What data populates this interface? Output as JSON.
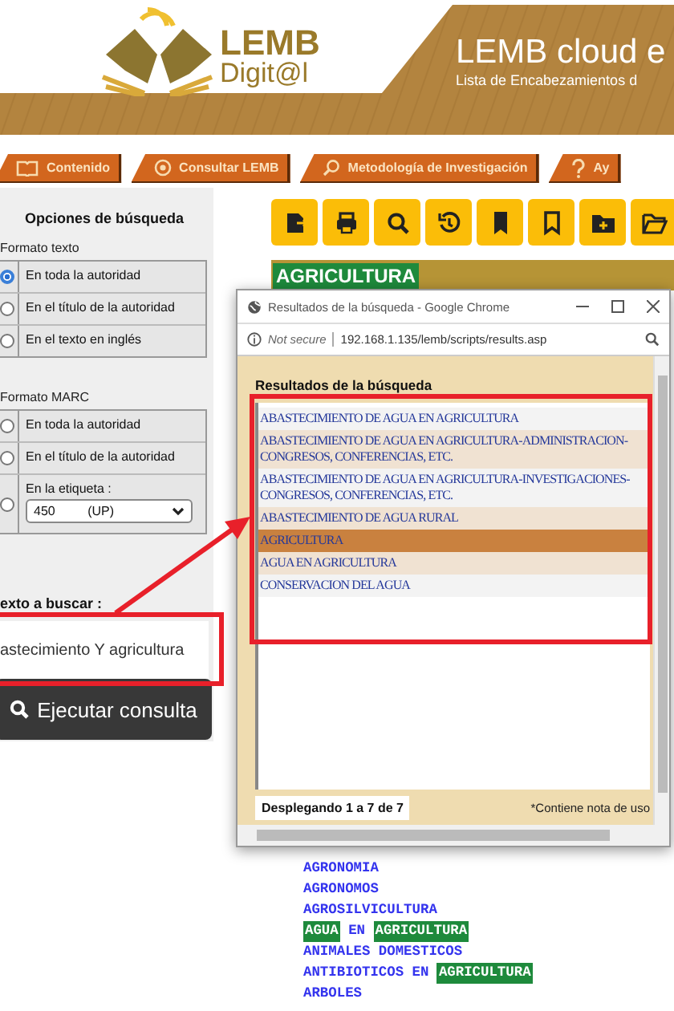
{
  "header": {
    "logo_line1": "LEMB",
    "logo_line2": "Digit@l",
    "title": "LEMB cloud e",
    "subtitle": "Lista de Encabezamientos d"
  },
  "nav_tabs": [
    "Contenido",
    "Consultar LEMB",
    "Metodología de Investigación",
    "Ay"
  ],
  "search_options": {
    "title": "Opciones de búsqueda",
    "groups": [
      {
        "label": "Formato texto",
        "options": [
          {
            "kind": "radio",
            "label": "En toda la autoridad",
            "selected": true
          },
          {
            "kind": "radio",
            "label": "En el título de la autoridad",
            "selected": false
          },
          {
            "kind": "radio",
            "label": "En el texto en inglés",
            "selected": false
          }
        ]
      },
      {
        "label": "Formato MARC",
        "options": [
          {
            "kind": "radio",
            "label": "En toda la autoridad",
            "selected": false
          },
          {
            "kind": "radio",
            "label": "En el título de la autoridad",
            "selected": false
          },
          {
            "kind": "radio_select",
            "label": "En la etiqueta :",
            "selected": false,
            "select_value": "450 (UP)"
          }
        ]
      }
    ]
  },
  "search": {
    "label": "exto a buscar :",
    "value": "astecimiento Y agricultura",
    "button": "Ejecutar consulta"
  },
  "heading": "AGRICULTURA",
  "popup": {
    "title": "Resultados de la búsqueda - Google Chrome",
    "security": "Not secure",
    "url": "192.168.1.135/lemb/scripts/results.asp",
    "heading": "Resultados de la búsqueda",
    "results": [
      {
        "text": "ABASTECIMIENTO DE AGUA EN AGRICULTURA",
        "selected": false
      },
      {
        "text": "ABASTECIMIENTO DE AGUA EN AGRICULTURA-ADMINISTRACION-CONGRESOS, CONFERENCIAS, ETC.",
        "selected": false
      },
      {
        "text": "ABASTECIMIENTO DE AGUA EN AGRICULTURA-INVESTIGACIONES-CONGRESOS, CONFERENCIAS, ETC.",
        "selected": false
      },
      {
        "text": "ABASTECIMIENTO DE AGUA RURAL",
        "selected": false
      },
      {
        "text": "AGRICULTURA",
        "selected": true
      },
      {
        "text": "AGUA EN AGRICULTURA",
        "selected": false
      },
      {
        "text": "CONSERVACION DEL AGUA",
        "selected": false
      }
    ],
    "count": "Desplegando 1 a 7 de 7",
    "note": "*Contiene nota de uso"
  },
  "heading_list": [
    {
      "segments": [
        {
          "text": "AGRONOMIA",
          "highlighted": false
        }
      ]
    },
    {
      "segments": [
        {
          "text": "AGRONOMOS",
          "highlighted": false
        }
      ]
    },
    {
      "segments": [
        {
          "text": "AGROSILVICULTURA",
          "highlighted": false
        }
      ]
    },
    {
      "segments": [
        {
          "text": "AGUA",
          "highlighted": true
        },
        {
          "text": "EN",
          "highlighted": false
        },
        {
          "text": "AGRICULTURA",
          "highlighted": true
        }
      ]
    },
    {
      "segments": [
        {
          "text": "ANIMALES DOMESTICOS",
          "highlighted": false
        }
      ]
    },
    {
      "segments": [
        {
          "text": "ANTIBIOTICOS",
          "highlighted": false
        },
        {
          "text": "EN",
          "highlighted": false
        },
        {
          "text": "AGRICULTURA",
          "highlighted": true
        }
      ]
    },
    {
      "segments": [
        {
          "text": "ARBOLES",
          "highlighted": false
        }
      ]
    }
  ]
}
